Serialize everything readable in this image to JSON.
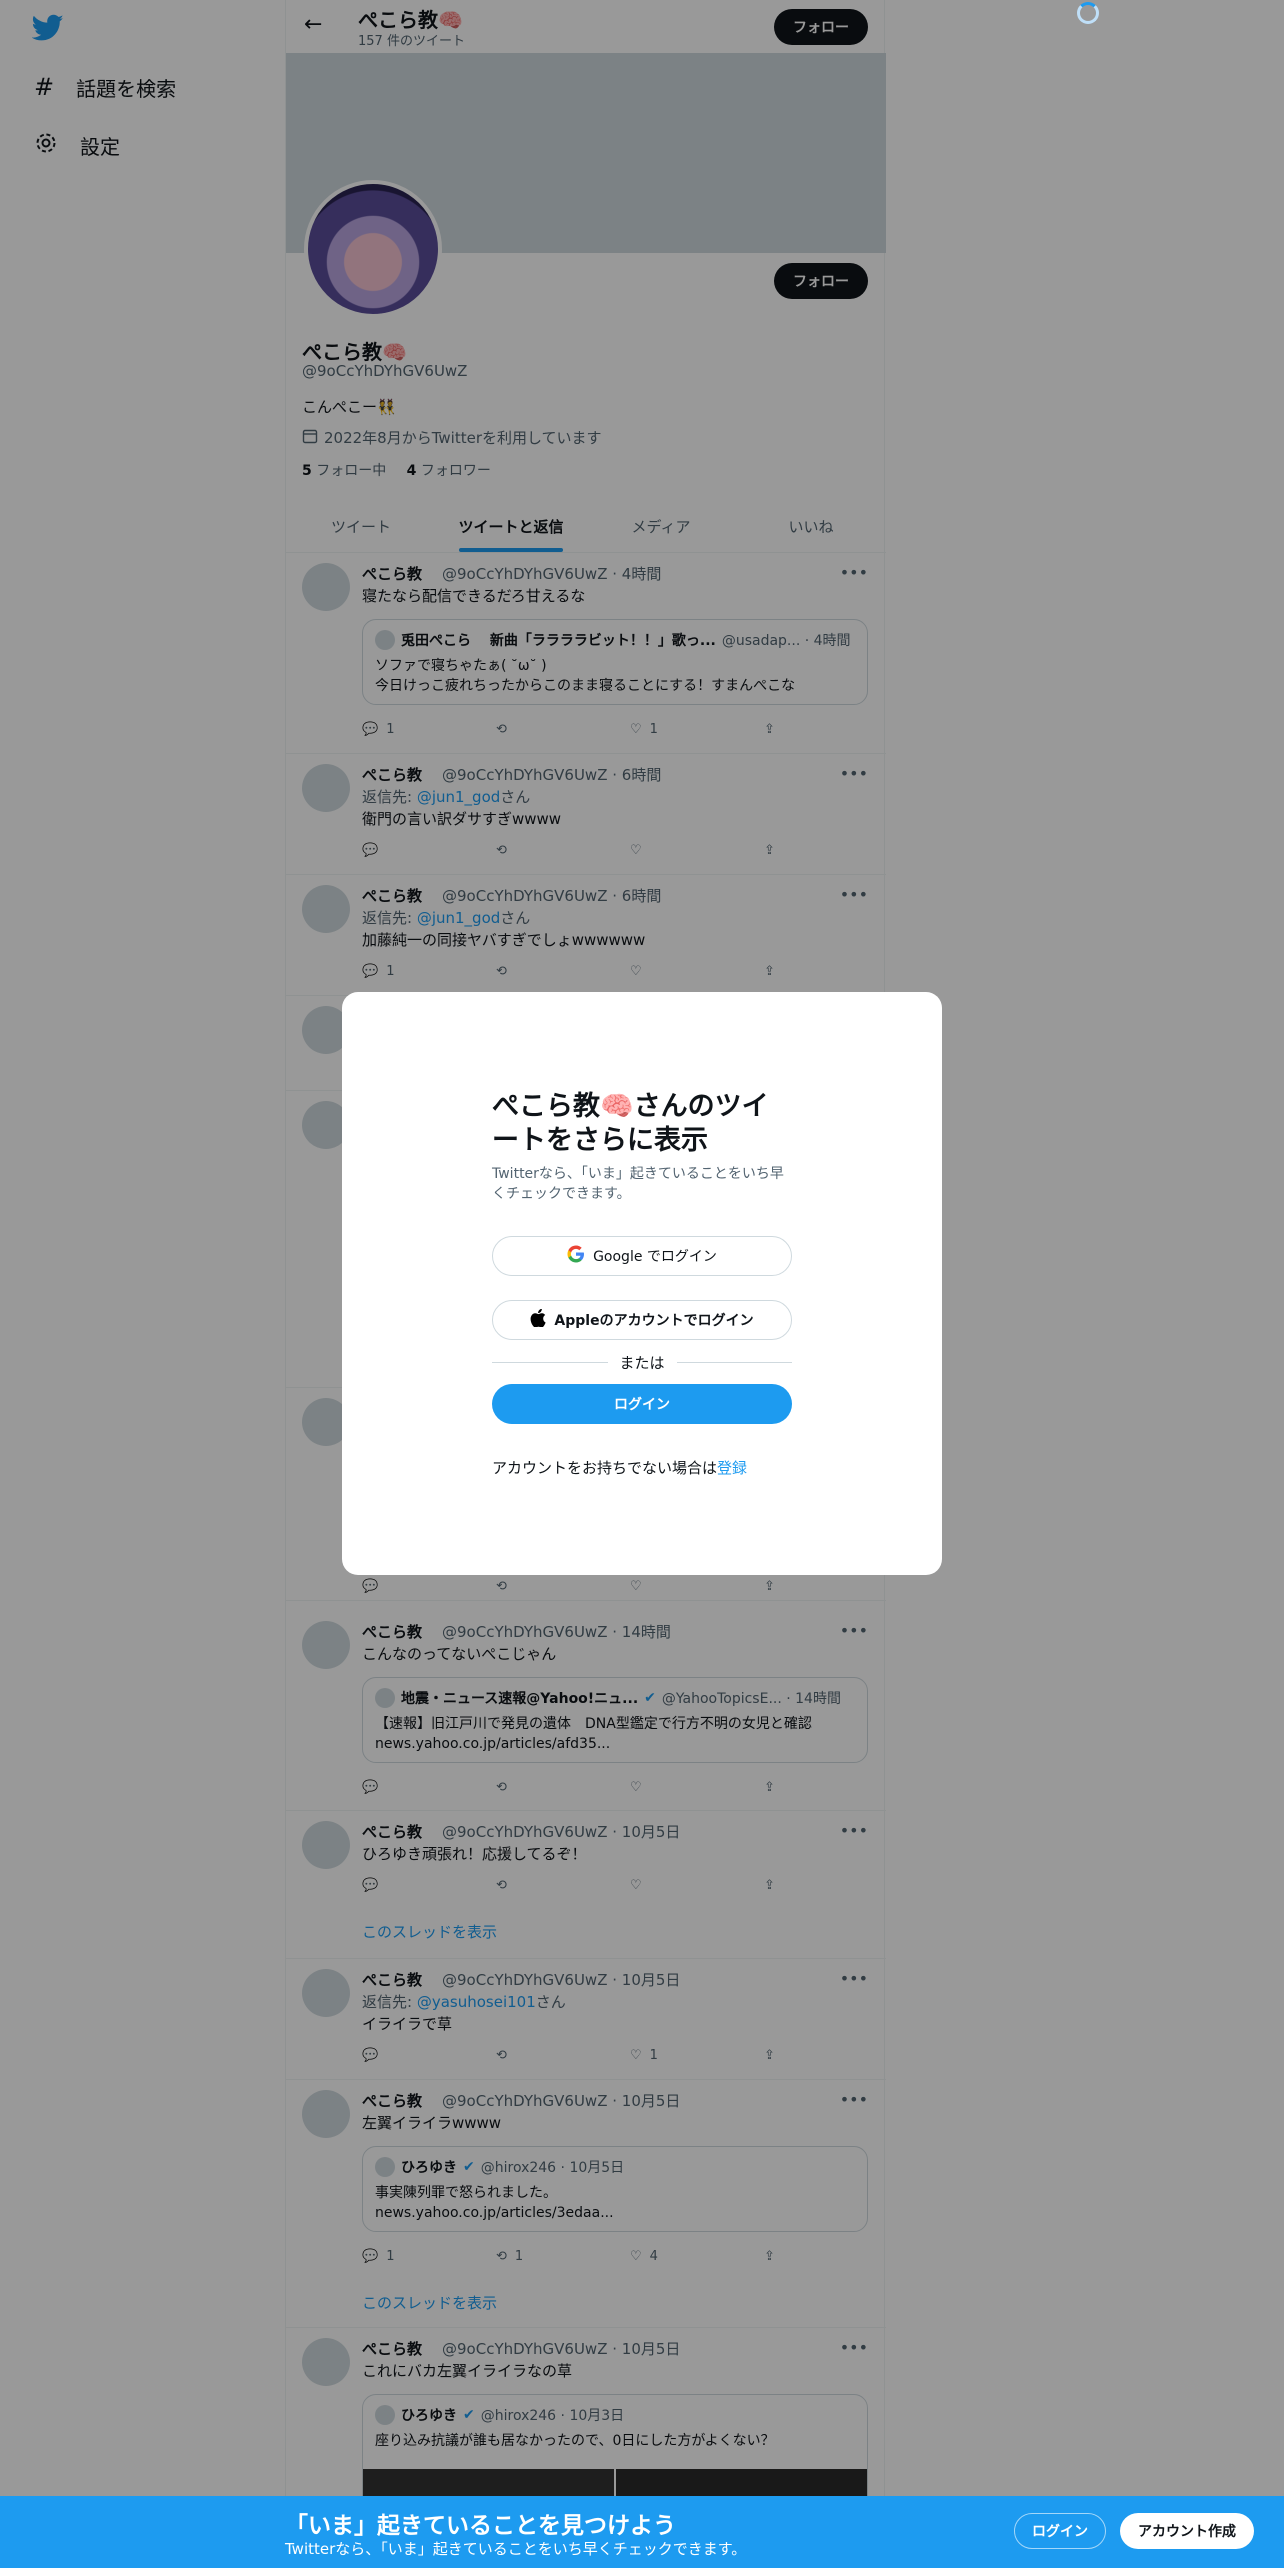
{
  "nav": {
    "explore_label": "話題を検索",
    "settings_label": "設定"
  },
  "header": {
    "name": "ぺこら教🧠",
    "tweet_count": "157 件のツイート",
    "follow_label": "フォロー"
  },
  "profile": {
    "name": "ぺこら教🧠",
    "handle": "@9oCcYhDYhGV6UwZ",
    "bio": "こんぺこー👯",
    "joined": "2022年8月からTwitterを利用しています",
    "following_count": "5",
    "following_label": "フォロー中",
    "followers_count": "4",
    "followers_label": "フォロワー",
    "follow_label": "フォロー"
  },
  "tabs": [
    "ツイート",
    "ツイートと返信",
    "メディア",
    "いいね"
  ],
  "tweets": [
    {
      "name": "ぺこら教",
      "meta": "@9oCcYhDYhGV6UwZ · 4時間",
      "text": "寝たなら配信できるだろ甘えるな",
      "quote_author": "兎田ぺこら　 新曲「ララララビット！！」歌っ...",
      "quote_meta": "@usadap... · 4時間",
      "quote_line1": "ソファで寝ちゃたぁ(  ˘ω˘ )",
      "quote_line2": "今日けっこ疲れちったからこのまま寝ることにする！すまんぺこな",
      "reply_count": "1",
      "like_count": "1"
    },
    {
      "name": "ぺこら教",
      "meta": "@9oCcYhDYhGV6UwZ · 6時間",
      "reply_prefix": "返信先: ",
      "reply_to": "@jun1_god",
      "reply_suffix": "さん",
      "text": "衛門の言い訳ダサすぎwwww"
    },
    {
      "name": "ぺこら教",
      "meta": "@9oCcYhDYhGV6UwZ · 6時間",
      "reply_prefix": "返信先: ",
      "reply_to": "@jun1_god",
      "reply_suffix": "さん",
      "text": "加藤純一の同接ヤバすぎでしょwwwwww",
      "reply_count": "1"
    },
    {
      "name": "ぺこら教",
      "meta": "@9oCcYhDYhGV6UwZ · 14時間",
      "text": "こんなのってないぺこじゃん",
      "quote_author": "地震・ニュース速報@Yahoo!ニュ...",
      "quote_meta": "@YahooTopicsE... · 14時間",
      "quote_line1": "【速報】旧江戸川で発見の遺体　DNA型鑑定で行方不明の女児と確認",
      "quote_line2": "news.yahoo.co.jp/articles/afd35..."
    },
    {
      "name": "ぺこら教",
      "meta": "@9oCcYhDYhGV6UwZ · 10月5日",
      "text": "ひろゆき頑張れ！応援してるぞ！",
      "thread": "このスレッドを表示"
    },
    {
      "name": "ぺこら教",
      "meta": "@9oCcYhDYhGV6UwZ · 10月5日",
      "reply_prefix": "返信先: ",
      "reply_to": "@yasuhosei101",
      "reply_suffix": "さん",
      "text": "イライラで草",
      "like_count": "1"
    },
    {
      "name": "ぺこら教",
      "meta": "@9oCcYhDYhGV6UwZ · 10月5日",
      "text": "左翼イライラwwww",
      "quote_author": "ひろゆき",
      "quote_meta": "@hirox246 · 10月5日",
      "quote_line1": "事実陳列罪で怒られました。",
      "quote_line2": "news.yahoo.co.jp/articles/3edaa...",
      "reply_count": "1",
      "retweet_count": "1",
      "like_count": "4",
      "thread": "このスレッドを表示"
    },
    {
      "name": "ぺこら教",
      "meta": "@9oCcYhDYhGV6UwZ · 10月5日",
      "text": "これにバカ左翼イライラなの草",
      "quote_author": "ひろゆき",
      "quote_meta": "@hirox246 · 10月3日",
      "quote_line1": "座り込み抗議が誰も居なかったので、0日にした方がよくない？"
    }
  ],
  "modal": {
    "title": "ぺこら教🧠さんのツイートをさらに表示",
    "subtitle": "Twitterなら、「いま」起きていることをいち早くチェックできます。",
    "google_label": "Google でログイン",
    "apple_label": "Appleのアカウントでログイン",
    "or_label": "または",
    "login_label": "ログイン",
    "signup_prefix": "アカウントをお持ちでない場合は",
    "signup_link": "登録"
  },
  "bottom_bar": {
    "title": "「いま」起きていることを見つけよう",
    "subtitle": "Twitterなら、「いま」起きていることをいち早くチェックできます。",
    "login_label": "ログイン",
    "signup_label": "アカウント作成"
  },
  "colors": {
    "accent": "#1d9bf0",
    "text": "#0f1419",
    "muted": "#536471",
    "banner": "#cfd9de"
  }
}
